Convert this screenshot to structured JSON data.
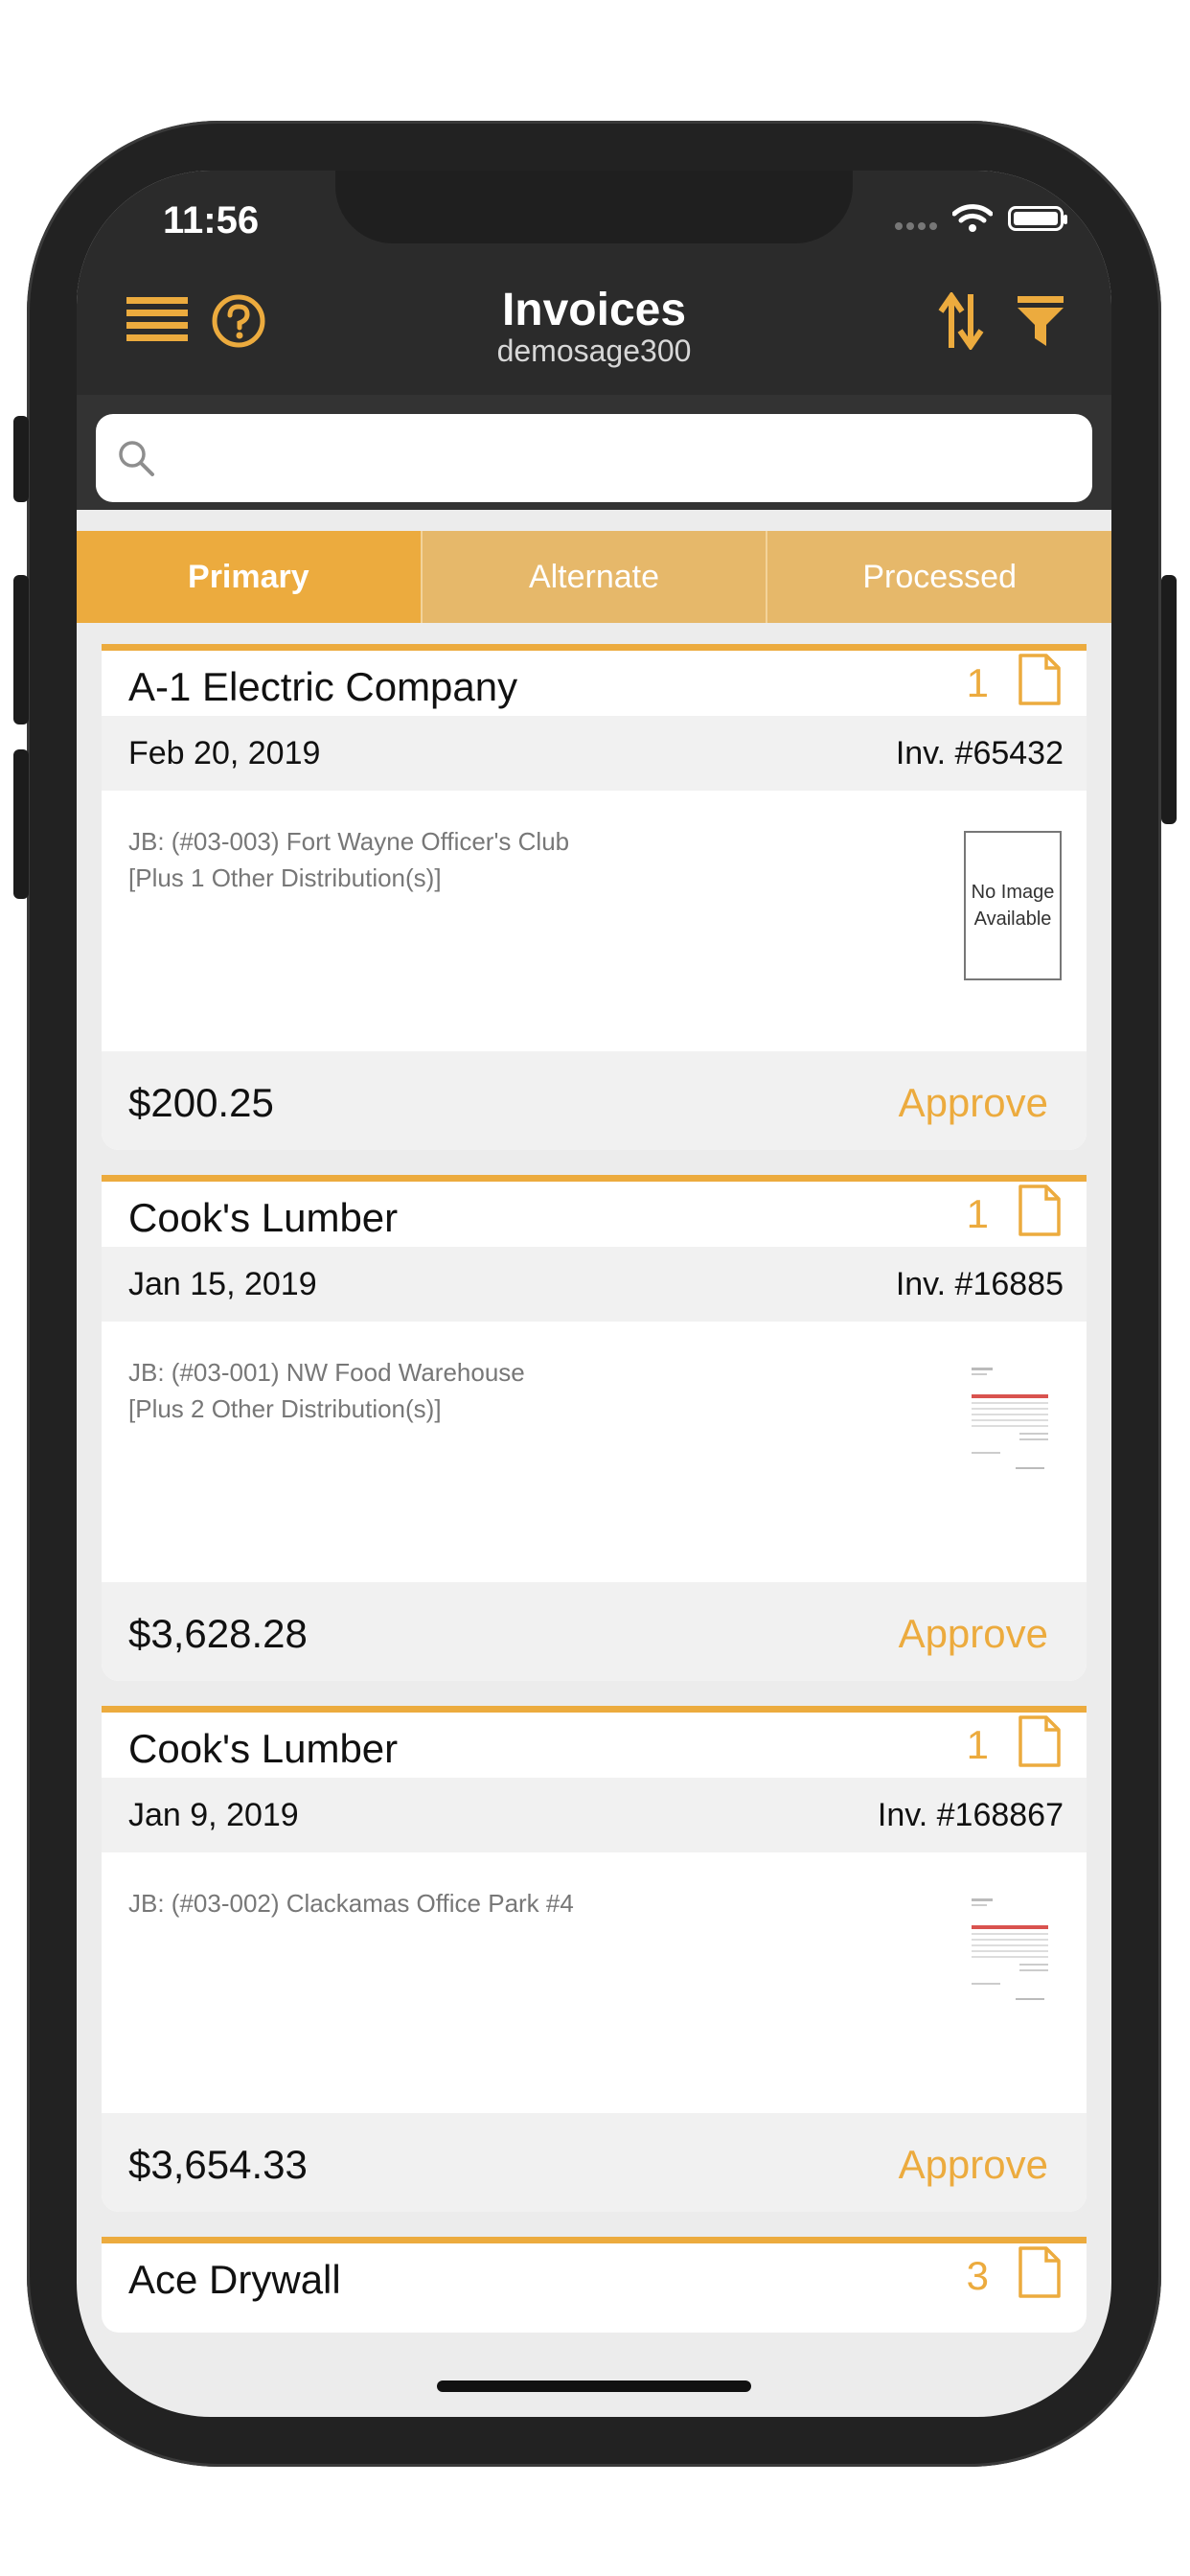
{
  "status": {
    "time": "11:56"
  },
  "header": {
    "title": "Invoices",
    "subtitle": "demosage300"
  },
  "search": {
    "value": "",
    "placeholder": ""
  },
  "tabs": [
    {
      "label": "Primary",
      "active": true
    },
    {
      "label": "Alternate",
      "active": false
    },
    {
      "label": "Processed",
      "active": false
    }
  ],
  "invoices": [
    {
      "vendor": "A-1 Electric Company",
      "count": "1",
      "date": "Feb 20, 2019",
      "invoice": "Inv. #65432",
      "dist_line1": "JB: (#03-003) Fort Wayne Officer's Club",
      "dist_line2": "[Plus 1 Other Distribution(s)]",
      "no_image_text": "No Image Available",
      "amount": "$200.25",
      "approve": "Approve"
    },
    {
      "vendor": "Cook's Lumber",
      "count": "1",
      "date": "Jan 15, 2019",
      "invoice": "Inv. #16885",
      "dist_line1": "JB: (#03-001) NW Food Warehouse",
      "dist_line2": "[Plus 2 Other Distribution(s)]",
      "amount": "$3,628.28",
      "approve": "Approve"
    },
    {
      "vendor": "Cook's Lumber",
      "count": "1",
      "date": "Jan 9, 2019",
      "invoice": "Inv. #168867",
      "dist_line1": "JB: (#03-002) Clackamas Office Park #4",
      "dist_line2": "",
      "amount": "$3,654.33",
      "approve": "Approve"
    },
    {
      "vendor": "Ace Drywall",
      "count": "3"
    }
  ],
  "colors": {
    "accent": "#ecab3e",
    "tab_inactive": "#e6b86a",
    "bar": "#2b2b2b"
  },
  "icons": {
    "menu": "menu-icon",
    "help": "help-icon",
    "sort": "sort-icon",
    "filter": "filter-icon",
    "search": "search-icon",
    "document": "document-icon"
  }
}
